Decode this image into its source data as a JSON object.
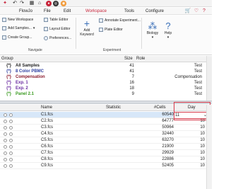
{
  "titlebar": {
    "app_name": "FlowJo"
  },
  "menu": {
    "items": [
      "FlowJo",
      "File",
      "Edit",
      "Workspace",
      "Tools",
      "Configure"
    ],
    "active_index": 3,
    "help_icon": "?"
  },
  "ribbon": {
    "navigate": {
      "new_workspace": "New Workspace",
      "add_samples": "Add Samples...",
      "create_group": "Create Group...",
      "table_editor": "Table Editor",
      "layout_editor": "Layout Editor",
      "preferences": "Preferences...",
      "label": "Navigate"
    },
    "experiment": {
      "add_keyword_line1": "Add",
      "add_keyword_line2": "Keyword",
      "annotate_experiment": "Annotate Experiment...",
      "plate_editor": "Plate Editor",
      "label": "Experiment"
    },
    "biology": "Biology",
    "help": "Help"
  },
  "groups": {
    "columns": {
      "group": "Group",
      "size": "Size",
      "role": "Role"
    },
    "rows": [
      {
        "name": "All Samples",
        "size": "41",
        "role": "Test",
        "color": "#222222"
      },
      {
        "name": "8 Color PBMC",
        "size": "41",
        "role": "Test",
        "color": "#2e3fa0"
      },
      {
        "name": "Compensation",
        "size": "7",
        "role": "Compensation",
        "color": "#8a1a2c"
      },
      {
        "name": "Exp. 1",
        "size": "16",
        "role": "Test",
        "color": "#6a2aa0"
      },
      {
        "name": "Exp. 2",
        "size": "18",
        "role": "Test",
        "color": "#6a2aa0"
      },
      {
        "name": "Panel 2.1",
        "size": "9",
        "role": "Test",
        "color": "#3a9a20"
      }
    ]
  },
  "samples": {
    "columns": {
      "name": "Name",
      "statistic": "Statistic",
      "cells": "#Cells",
      "day": "Day"
    },
    "editing_value": "11",
    "rows": [
      {
        "name": "C1.fcs",
        "cells": "60540",
        "day": "11"
      },
      {
        "name": "C2.fcs",
        "cells": "64777",
        "day": "10"
      },
      {
        "name": "C3.fcs",
        "cells": "50964",
        "day": "10"
      },
      {
        "name": "C4.fcs",
        "cells": "32440",
        "day": "10"
      },
      {
        "name": "C5.fcs",
        "cells": "63270",
        "day": "10"
      },
      {
        "name": "C6.fcs",
        "cells": "21900",
        "day": "10"
      },
      {
        "name": "C7.fcs",
        "cells": "29929",
        "day": "10"
      },
      {
        "name": "C8.fcs",
        "cells": "22886",
        "day": "10"
      },
      {
        "name": "C9.fcs",
        "cells": "52405",
        "day": "10"
      }
    ]
  }
}
